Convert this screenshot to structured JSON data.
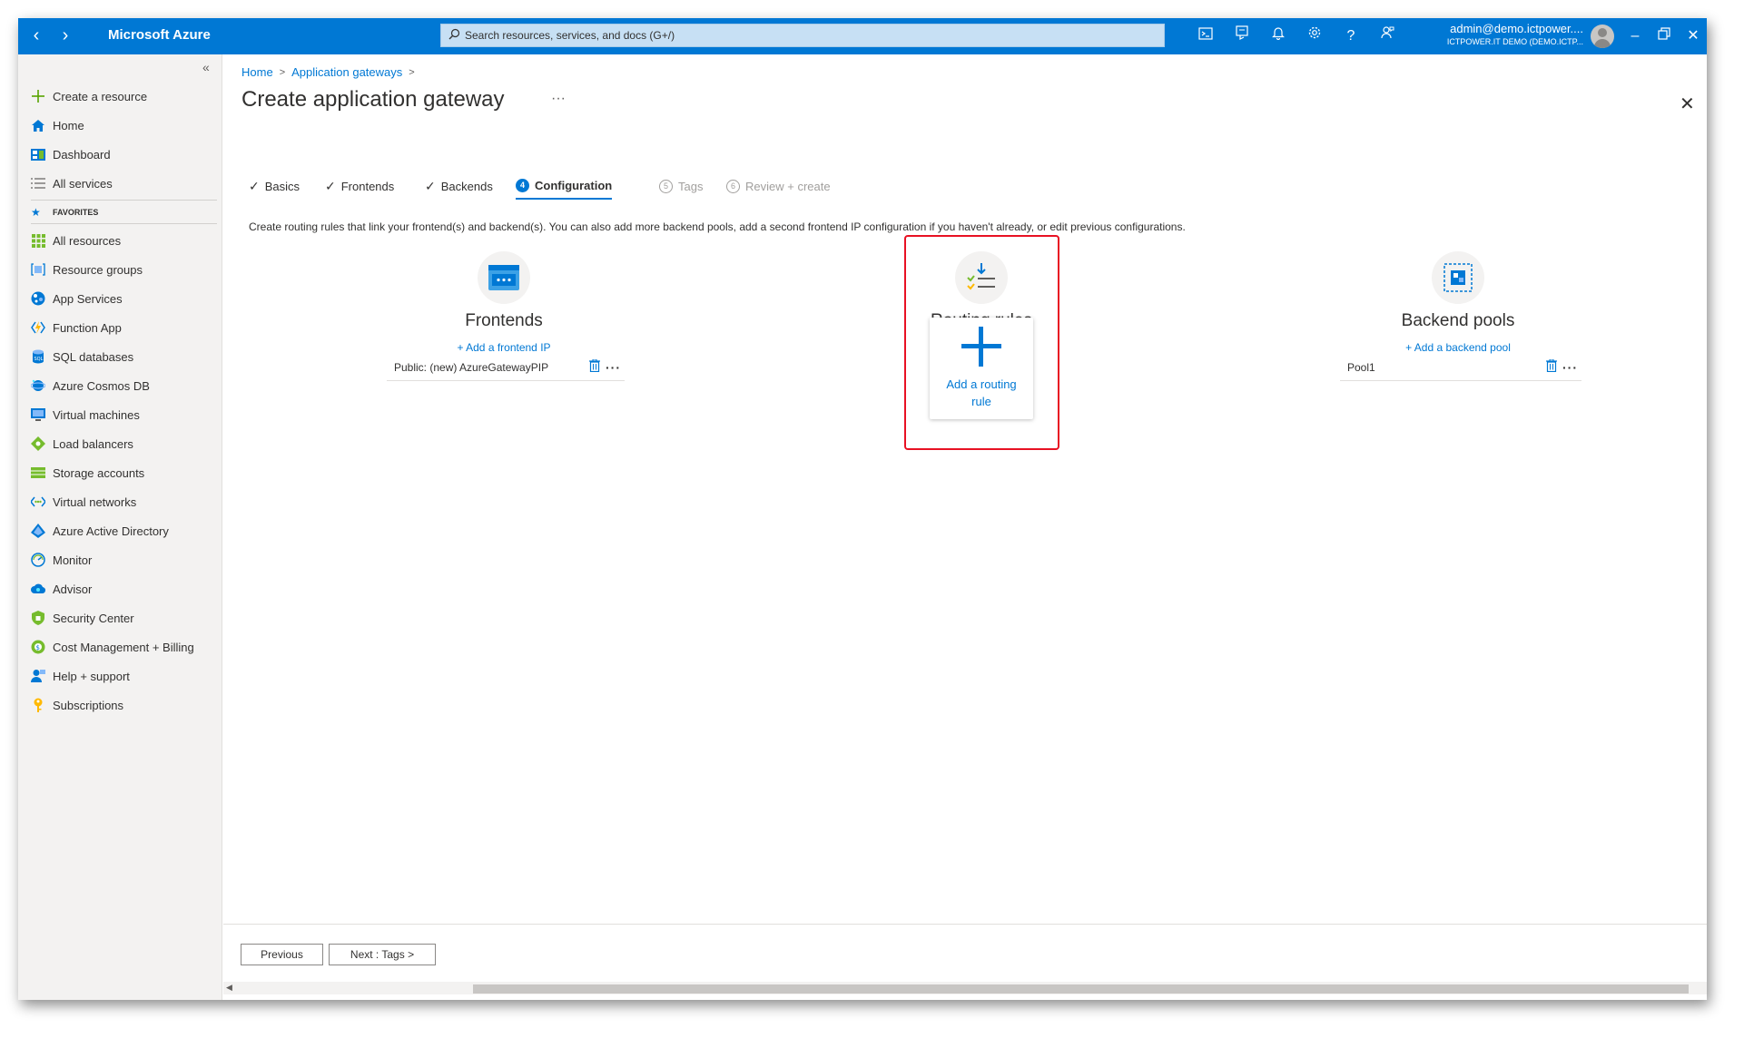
{
  "topbar": {
    "brand": "Microsoft Azure",
    "search_placeholder": "Search resources, services, and docs (G+/)",
    "user_name": "admin@demo.ictpower....",
    "user_tenant": "ICTPOWER.IT DEMO (DEMO.ICTP...",
    "icons": [
      "cloud-shell-icon",
      "directory-filter-icon",
      "notifications-icon",
      "settings-icon",
      "help-icon",
      "feedback-icon"
    ]
  },
  "sidebar": {
    "collapse_label": "«",
    "create": "Create a resource",
    "home": "Home",
    "dashboard": "Dashboard",
    "all_services": "All services",
    "favorites_label": "FAVORITES",
    "favorites": [
      {
        "label": "All resources",
        "icon": "all-resources-icon"
      },
      {
        "label": "Resource groups",
        "icon": "resource-groups-icon"
      },
      {
        "label": "App Services",
        "icon": "app-services-icon"
      },
      {
        "label": "Function App",
        "icon": "function-app-icon"
      },
      {
        "label": "SQL databases",
        "icon": "sql-databases-icon"
      },
      {
        "label": "Azure Cosmos DB",
        "icon": "cosmos-db-icon"
      },
      {
        "label": "Virtual machines",
        "icon": "virtual-machines-icon"
      },
      {
        "label": "Load balancers",
        "icon": "load-balancers-icon"
      },
      {
        "label": "Storage accounts",
        "icon": "storage-accounts-icon"
      },
      {
        "label": "Virtual networks",
        "icon": "virtual-networks-icon"
      },
      {
        "label": "Azure Active Directory",
        "icon": "active-directory-icon"
      },
      {
        "label": "Monitor",
        "icon": "monitor-icon"
      },
      {
        "label": "Advisor",
        "icon": "advisor-icon"
      },
      {
        "label": "Security Center",
        "icon": "security-center-icon"
      },
      {
        "label": "Cost Management + Billing",
        "icon": "cost-management-icon"
      },
      {
        "label": "Help + support",
        "icon": "help-support-icon"
      },
      {
        "label": "Subscriptions",
        "icon": "subscriptions-icon"
      }
    ]
  },
  "breadcrumb": {
    "home": "Home",
    "app_gateways": "Application gateways"
  },
  "page": {
    "title": "Create application gateway",
    "more": "···",
    "description": "Create routing rules that link your frontend(s) and backend(s). You can also add more backend pools, add a second frontend IP configuration if you haven't already, or edit previous configurations."
  },
  "tabs": [
    {
      "label": "Basics",
      "state": "done"
    },
    {
      "label": "Frontends",
      "state": "done"
    },
    {
      "label": "Backends",
      "state": "done"
    },
    {
      "label": "Configuration",
      "state": "active",
      "num": "4"
    },
    {
      "label": "Tags",
      "state": "disabled",
      "num": "5"
    },
    {
      "label": "Review + create",
      "state": "disabled",
      "num": "6"
    }
  ],
  "frontends": {
    "title": "Frontends",
    "add_link": "+ Add a frontend IP",
    "items": [
      "Public: (new) AzureGatewayPIP"
    ]
  },
  "routing": {
    "title": "Routing rules",
    "add_label": "Add a routing rule"
  },
  "backends": {
    "title": "Backend pools",
    "add_link": "+ Add a backend pool",
    "items": [
      "Pool1"
    ]
  },
  "footer": {
    "previous": "Previous",
    "next": "Next : Tags >"
  },
  "colors": {
    "accent": "#0078d4",
    "highlight": "#e81123"
  }
}
